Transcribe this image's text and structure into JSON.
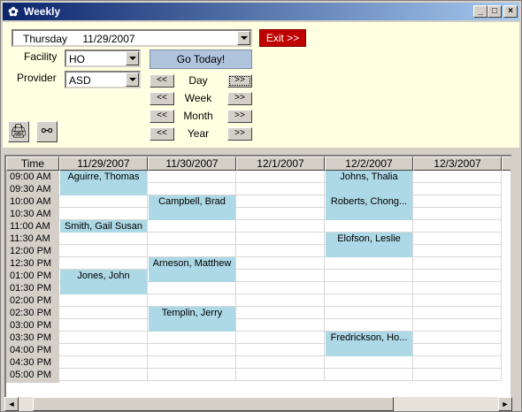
{
  "window": {
    "title": "Weekly",
    "minimize": "_",
    "maximize": "□",
    "close": "×"
  },
  "top": {
    "date_day": "Thursday",
    "date_value": "11/29/2007",
    "exit_label": "Exit >>",
    "facility_label": "Facility",
    "facility_value": "HO",
    "provider_label": "Provider",
    "provider_value": "ASD",
    "today_label": "Go Today!",
    "nav_prev": "<<",
    "nav_next": ">>",
    "nav_day": "Day",
    "nav_week": "Week",
    "nav_month": "Month",
    "nav_year": "Year"
  },
  "icons": {
    "print": "printer-icon",
    "find": "binoculars-icon"
  },
  "grid": {
    "time_header": "Time",
    "dates": [
      "11/29/2007",
      "11/30/2007",
      "12/1/2007",
      "12/2/2007",
      "12/3/2007"
    ],
    "times": [
      "09:00 AM",
      "09:30 AM",
      "10:00 AM",
      "10:30 AM",
      "11:00 AM",
      "11:30 AM",
      "12:00 PM",
      "12:30 PM",
      "01:00 PM",
      "01:30 PM",
      "02:00 PM",
      "02:30 PM",
      "03:00 PM",
      "03:30 PM",
      "04:00 PM",
      "04:30 PM",
      "05:00 PM"
    ],
    "appointments": [
      {
        "col": 0,
        "start": 0,
        "span": 2,
        "name": "Aguirre, Thomas"
      },
      {
        "col": 0,
        "start": 4,
        "span": 1,
        "name": "Smith, Gail Susan"
      },
      {
        "col": 0,
        "start": 8,
        "span": 2,
        "name": "Jones, John"
      },
      {
        "col": 1,
        "start": 2,
        "span": 2,
        "name": "Campbell, Brad"
      },
      {
        "col": 1,
        "start": 7,
        "span": 2,
        "name": "Arneson, Matthew"
      },
      {
        "col": 1,
        "start": 11,
        "span": 2,
        "name": "Templin, Jerry"
      },
      {
        "col": 3,
        "start": 0,
        "span": 2,
        "name": "Johns, Thalia"
      },
      {
        "col": 3,
        "start": 2,
        "span": 2,
        "name": "Roberts, Chong..."
      },
      {
        "col": 3,
        "start": 5,
        "span": 2,
        "name": "Elofson, Leslie"
      },
      {
        "col": 3,
        "start": 13,
        "span": 2,
        "name": "Fredrickson, Ho..."
      }
    ]
  },
  "scrollbar": {
    "left": "◄",
    "right": "►"
  }
}
